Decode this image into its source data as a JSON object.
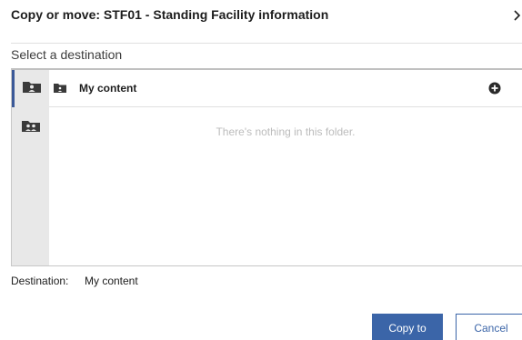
{
  "dialog": {
    "title": "Copy or move:  STF01 - Standing Facility information",
    "subtitle": "Select a destination",
    "close_icon": "chevron-right-icon"
  },
  "rail": {
    "items": [
      {
        "icon": "user-folder-icon",
        "selected": true
      },
      {
        "icon": "team-folder-icon",
        "selected": false
      }
    ]
  },
  "folder": {
    "name": "My content",
    "icon": "small-folder-icon",
    "action_icon": "add-circle-icon",
    "empty_message": "There's nothing in this folder."
  },
  "destination": {
    "label": "Destination:",
    "value": "My content"
  },
  "buttons": {
    "primary": "Copy to",
    "secondary": "Cancel"
  },
  "colors": {
    "accent": "#3b65a8",
    "rail_bg": "#e8e8e8",
    "selected_border": "#3b5998",
    "empty_text": "#bcbcbc"
  }
}
